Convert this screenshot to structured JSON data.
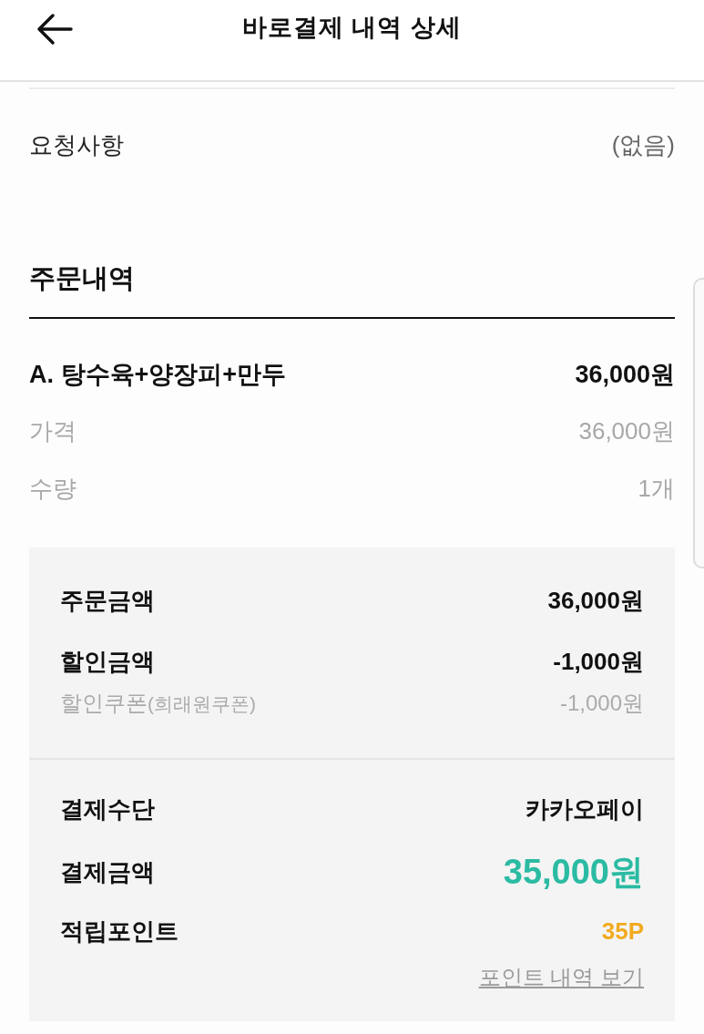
{
  "header": {
    "title": "바로결제 내역 상세"
  },
  "request": {
    "label": "요청사항",
    "value": "(없음)"
  },
  "order": {
    "title": "주문내역",
    "item": {
      "name": "A. 탕수육+양장피+만두",
      "price": "36,000원"
    },
    "details": [
      {
        "label": "가격",
        "value": "36,000원"
      },
      {
        "label": "수량",
        "value": "1개"
      }
    ]
  },
  "summary": {
    "groups": [
      {
        "rows": [
          {
            "kind": "main",
            "label": "주문금액",
            "value": "36,000원"
          },
          {
            "kind": "main",
            "label": "할인금액",
            "value": "-1,000원"
          },
          {
            "kind": "sub",
            "label": "할인쿠폰",
            "note": "(희래원쿠폰)",
            "value": "-1,000원"
          }
        ]
      },
      {
        "rows": [
          {
            "kind": "main",
            "label": "결제수단",
            "value": "카카오페이"
          },
          {
            "kind": "total",
            "label": "결제금액",
            "value": "35,000원"
          },
          {
            "kind": "points",
            "label": "적립포인트",
            "value": "35P"
          }
        ],
        "link": "포인트 내역 보기"
      }
    ]
  }
}
